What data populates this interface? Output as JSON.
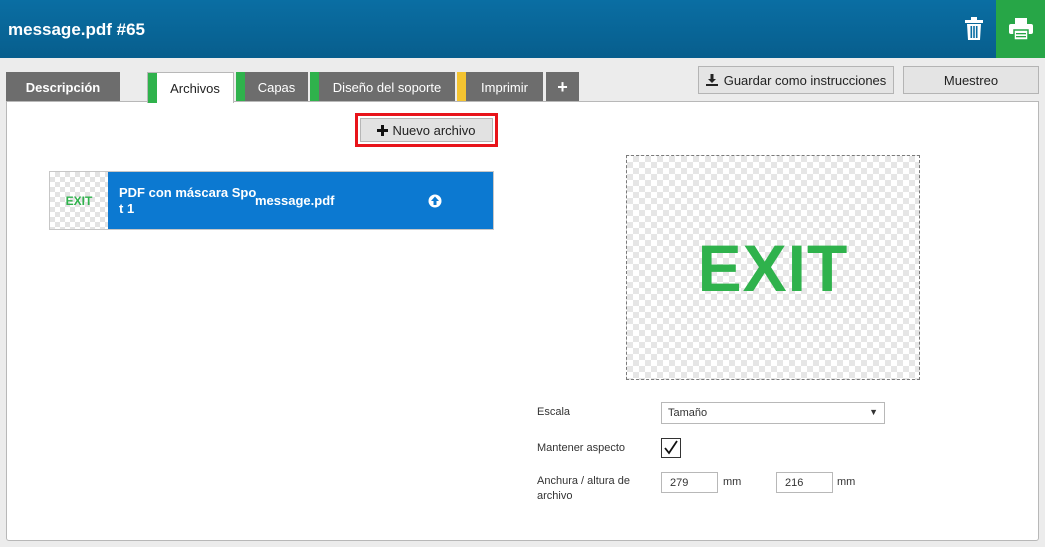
{
  "header": {
    "title": "message.pdf #65",
    "trash_icon": "trash-icon",
    "print_icon": "printer-icon"
  },
  "tabs": [
    {
      "label": "Descripción",
      "stripe": null
    },
    {
      "label": "Archivos",
      "stripe": "#2fb24c",
      "active": true
    },
    {
      "label": "Capas",
      "stripe": "#2fb24c"
    },
    {
      "label": "Diseño del soporte",
      "stripe": "#2fb24c"
    },
    {
      "label": "Imprimir",
      "stripe": "#f4c431"
    },
    {
      "label": "+",
      "stripe": null
    }
  ],
  "toolbar": {
    "save_instructions_label": "Guardar como instrucciones",
    "sampling_label": "Muestreo",
    "new_file_label": "Nuevo archivo"
  },
  "files": [
    {
      "thumbnail_text": "EXIT",
      "type": "PDF con máscara Spot 1",
      "name": "message.pdf"
    }
  ],
  "preview": {
    "text": "EXIT",
    "color": "#2fb24c"
  },
  "form": {
    "scale_label": "Escala",
    "scale_value": "Tamaño",
    "keep_aspect_label": "Mantener aspecto",
    "keep_aspect_checked": true,
    "size_label": "Anchura / altura de archivo",
    "width_value": "279",
    "height_value": "216",
    "unit": "mm"
  },
  "colors": {
    "header": "#0a6ea3",
    "print_button": "#27a647",
    "selected_row": "#0c79d1",
    "highlight": "#e8141a"
  }
}
